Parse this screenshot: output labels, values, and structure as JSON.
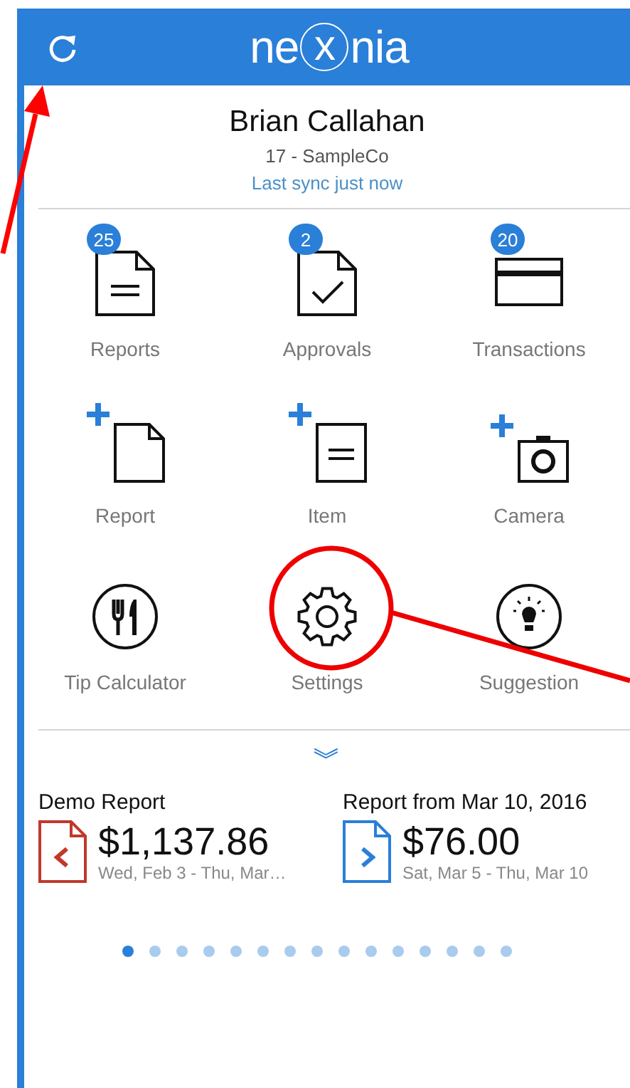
{
  "header": {
    "logo": {
      "before": "ne",
      "mark": "x",
      "after": "nia"
    }
  },
  "profile": {
    "name": "Brian Callahan",
    "company": "17 - SampleCo",
    "sync": "Last sync just now"
  },
  "tiles": [
    {
      "kind": "report",
      "label": "Reports",
      "badge": "25"
    },
    {
      "kind": "approval",
      "label": "Approvals",
      "badge": "2"
    },
    {
      "kind": "card",
      "label": "Transactions",
      "badge": "20"
    },
    {
      "kind": "new-report",
      "label": "Report"
    },
    {
      "kind": "new-item",
      "label": "Item"
    },
    {
      "kind": "camera",
      "label": "Camera"
    },
    {
      "kind": "tip",
      "label": "Tip Calculator"
    },
    {
      "kind": "settings",
      "label": "Settings"
    },
    {
      "kind": "idea",
      "label": "Suggestion"
    }
  ],
  "expand": {
    "glyph": "︾"
  },
  "reports": [
    {
      "kind": "previous",
      "title": "Demo Report",
      "amount": "$1,137.86",
      "dates": "Wed, Feb 3 - Thu, Mar…"
    },
    {
      "kind": "next",
      "title": "Report from Mar 10, 2016",
      "amount": "$76.00",
      "dates": "Sat, Mar 5 - Thu, Mar 10"
    }
  ],
  "pager": [
    {
      "selected": true
    },
    {
      "selected": false
    },
    {
      "selected": false
    },
    {
      "selected": false
    },
    {
      "selected": false
    },
    {
      "selected": false
    },
    {
      "selected": false
    },
    {
      "selected": false
    },
    {
      "selected": false
    },
    {
      "selected": false
    },
    {
      "selected": false
    },
    {
      "selected": false
    },
    {
      "selected": false
    },
    {
      "selected": false
    },
    {
      "selected": false
    }
  ]
}
